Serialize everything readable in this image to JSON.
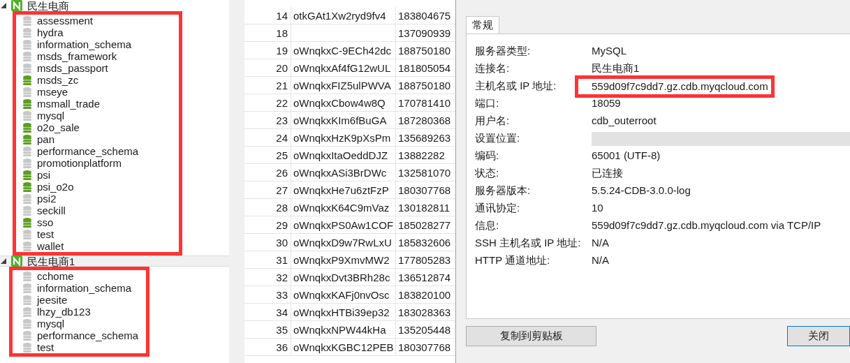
{
  "tree": [
    {
      "name": "民生电商",
      "expanded": true,
      "selected": false,
      "children": [
        {
          "name": "assessment",
          "open": false
        },
        {
          "name": "hydra",
          "open": false
        },
        {
          "name": "information_schema",
          "open": false
        },
        {
          "name": "msds_framework",
          "open": false
        },
        {
          "name": "msds_passport",
          "open": false
        },
        {
          "name": "msds_zc",
          "open": true
        },
        {
          "name": "mseye",
          "open": false
        },
        {
          "name": "msmall_trade",
          "open": true
        },
        {
          "name": "mysql",
          "open": false
        },
        {
          "name": "o2o_sale",
          "open": true
        },
        {
          "name": "pan",
          "open": true
        },
        {
          "name": "performance_schema",
          "open": false
        },
        {
          "name": "promotionplatform",
          "open": false
        },
        {
          "name": "psi",
          "open": true
        },
        {
          "name": "psi_o2o",
          "open": true
        },
        {
          "name": "psi2",
          "open": false
        },
        {
          "name": "seckill",
          "open": false
        },
        {
          "name": "sso",
          "open": true
        },
        {
          "name": "test",
          "open": false
        },
        {
          "name": "wallet",
          "open": false
        }
      ]
    },
    {
      "name": "民生电商1",
      "expanded": true,
      "selected": true,
      "children": [
        {
          "name": "cchome",
          "open": false
        },
        {
          "name": "information_schema",
          "open": false
        },
        {
          "name": "jeesite",
          "open": false
        },
        {
          "name": "lhzy_db123",
          "open": false
        },
        {
          "name": "mysql",
          "open": false
        },
        {
          "name": "performance_schema",
          "open": false
        },
        {
          "name": "test",
          "open": false
        }
      ]
    }
  ],
  "table": {
    "rows": [
      [
        "14",
        "otkGAt1Xw2ryd9fv4",
        "183804675"
      ],
      [
        "18",
        "",
        "137090939"
      ],
      [
        "19",
        "oWnqkxC-9ECh42dc",
        "188750180"
      ],
      [
        "20",
        "oWnqkxAf4fG12wUL",
        "181805054"
      ],
      [
        "21",
        "oWnqkxFIZ5ulPWVA",
        "188750180"
      ],
      [
        "22",
        "oWnqkxCbow4w8Q",
        "170781410"
      ],
      [
        "23",
        "oWnqkxKIm6fBuGA",
        "187280368"
      ],
      [
        "24",
        "oWnqkxHzK9pXsPm",
        "135689263"
      ],
      [
        "25",
        "oWnqkxItaOeddDJZ",
        "13882282"
      ],
      [
        "26",
        "oWnqkxASi3BrDWc",
        "132581070"
      ],
      [
        "27",
        "oWnqkxHe7u6ztFzP",
        "180307768"
      ],
      [
        "28",
        "oWnqkxK64C9mVaz",
        "130182811"
      ],
      [
        "29",
        "oWnqkxPS0Aw1COF",
        "185028277"
      ],
      [
        "30",
        "oWnqkxD9w7RwLxU",
        "185832606"
      ],
      [
        "31",
        "oWnqkxP9XmvMW2",
        "177805283"
      ],
      [
        "32",
        "oWnqkxDvt3BRh28c",
        "136512874"
      ],
      [
        "33",
        "oWnqkxKAFj0nvOsc",
        "183820100"
      ],
      [
        "34",
        "oWnqkxHTBi39ep32",
        "183028363"
      ],
      [
        "35",
        "oWnqkxNPW44kHa",
        "135205448"
      ],
      [
        "36",
        "oWnqkxKGBC12PEB",
        "180307768"
      ]
    ]
  },
  "dialog": {
    "tabs": [
      {
        "label": "常规",
        "selected": true
      }
    ],
    "fields": [
      {
        "label": "服务器类型:",
        "value": "MySQL",
        "kind": "plain"
      },
      {
        "label": "连接名:",
        "value": "民生电商1",
        "kind": "plain"
      },
      {
        "label": "主机名或 IP 地址:",
        "value": "559d09f7c9dd7.gz.cdb.myqcloud.com",
        "kind": "marked"
      },
      {
        "label": "端口:",
        "value": "18059",
        "kind": "plain"
      },
      {
        "label": "用户名:",
        "value": "cdb_outerroot",
        "kind": "plain"
      },
      {
        "label": "设置位置:",
        "kind": "redacted"
      },
      {
        "label": "编码:",
        "value": "65001 (UTF-8)",
        "kind": "plain"
      },
      {
        "label": "状态:",
        "value": "已连接",
        "kind": "plain"
      },
      {
        "label": "服务器版本:",
        "value": "5.5.24-CDB-3.0.0-log",
        "kind": "plain"
      },
      {
        "label": "通讯协定:",
        "value": "10",
        "kind": "plain"
      },
      {
        "label": "信息:",
        "value": "559d09f7c9dd7.gz.cdb.myqcloud.com via TCP/IP",
        "kind": "plain"
      },
      {
        "label": "SSH 主机名或 IP 地址:",
        "value": "N/A",
        "kind": "plain"
      },
      {
        "label": "HTTP 通道地址:",
        "value": "N/A",
        "kind": "plain"
      }
    ],
    "buttons": [
      "复制到剪贴板",
      "关闭"
    ]
  }
}
